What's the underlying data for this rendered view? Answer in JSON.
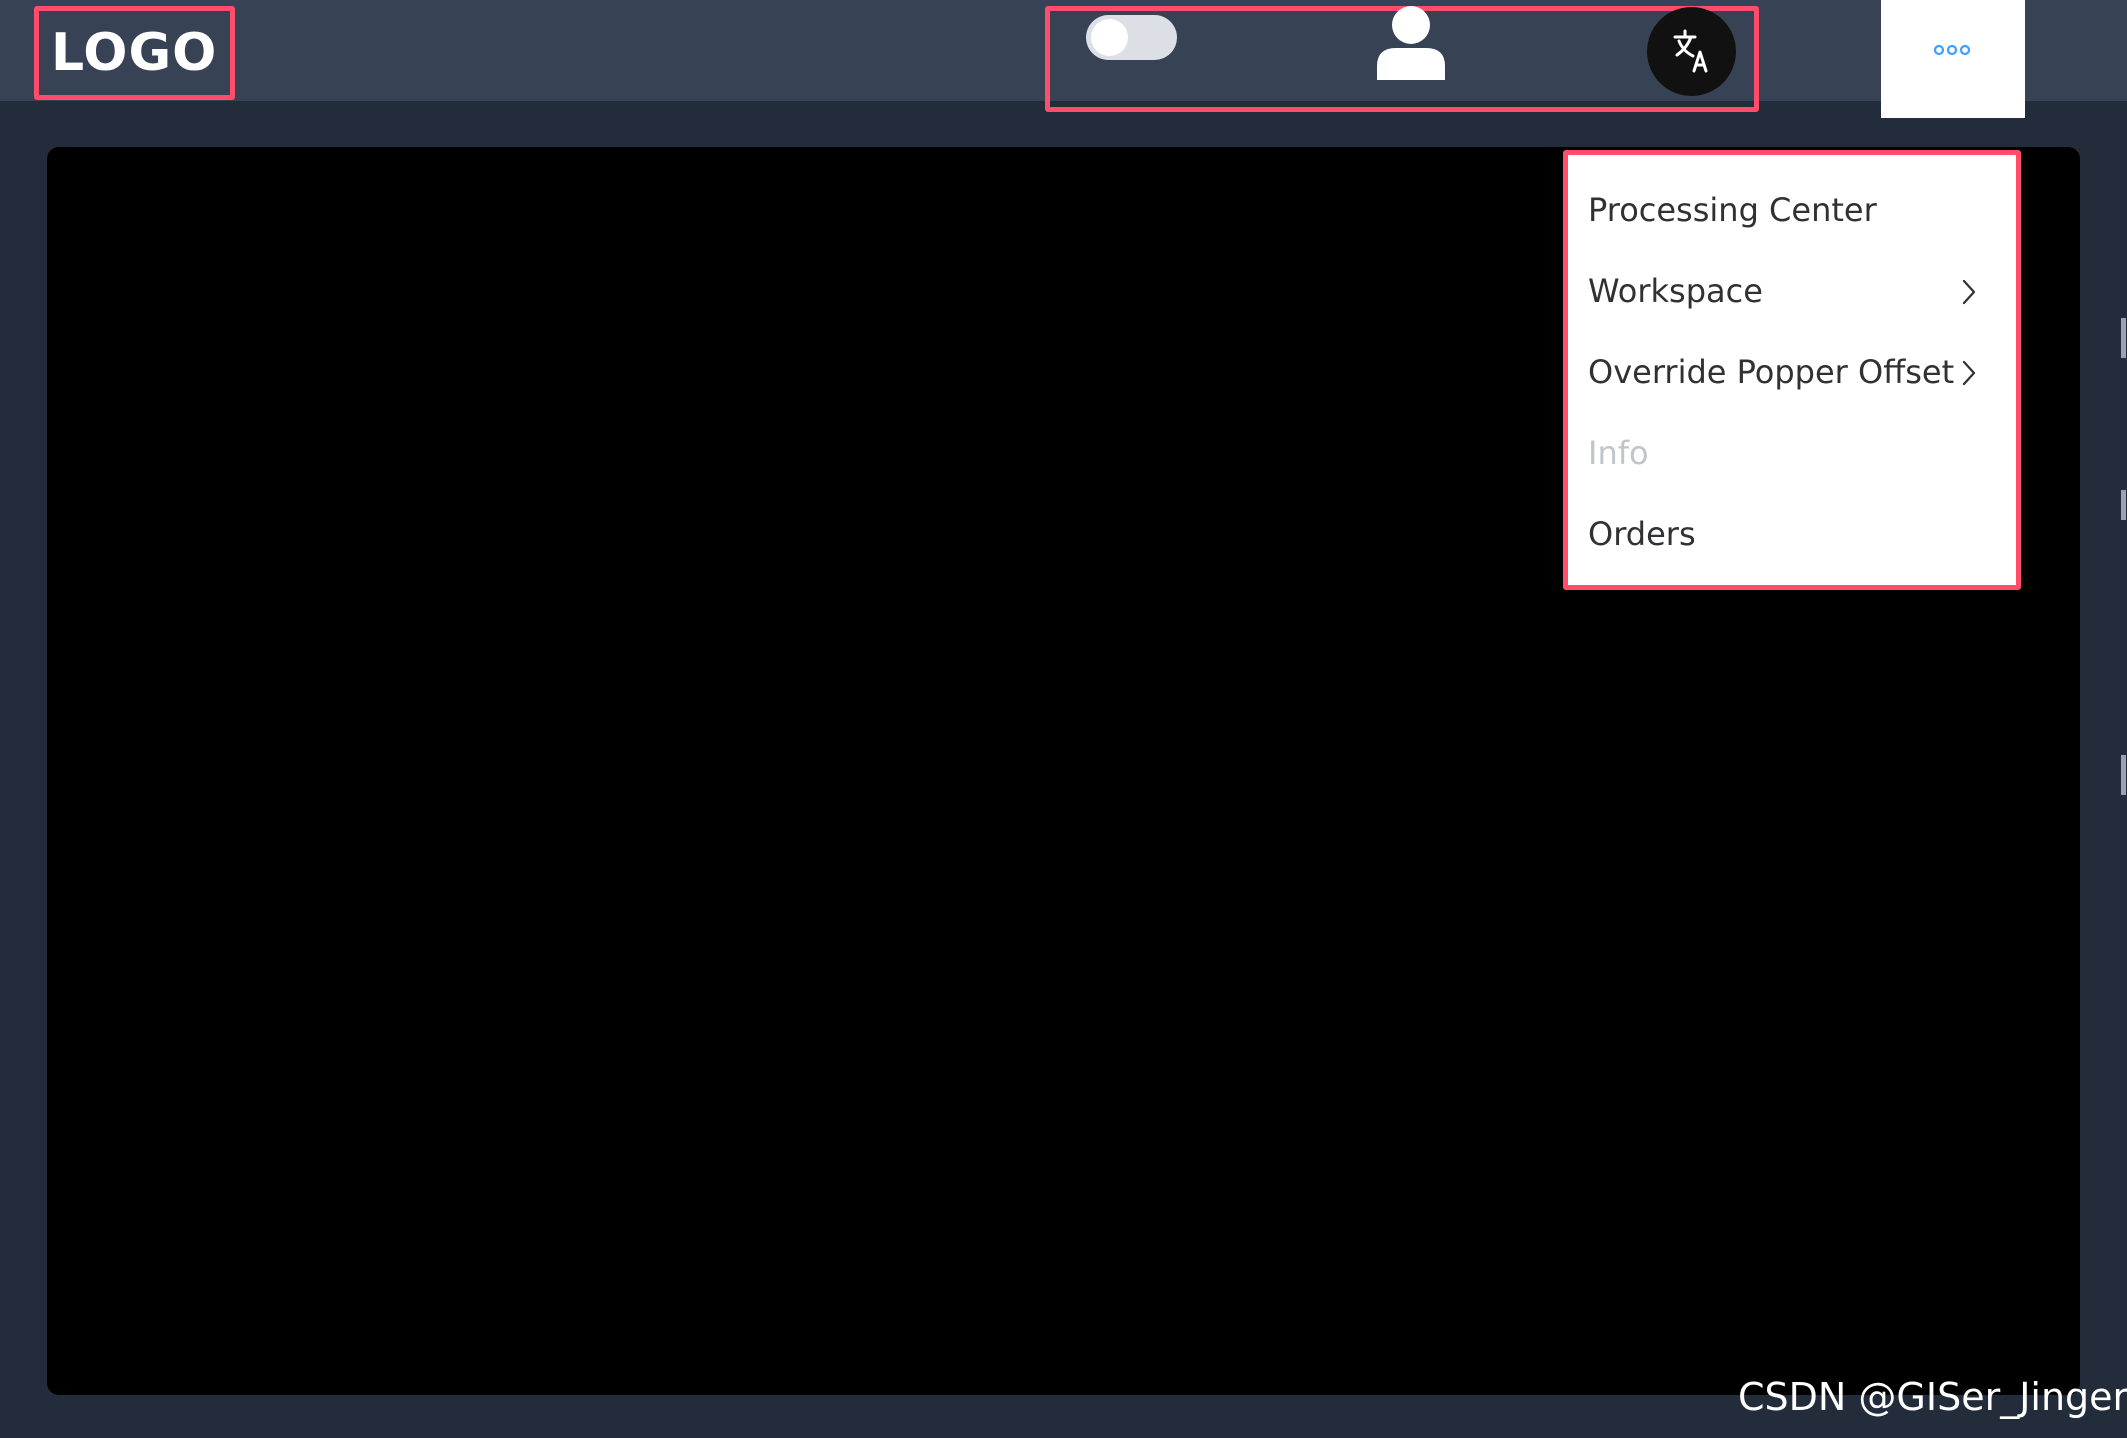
{
  "header": {
    "logo_text": "LOGO",
    "theme_toggle": {
      "state": "off",
      "icon": "toggle-switch"
    },
    "user_icon": "user-icon",
    "language_icon": "translate-icon",
    "more_icon": "ellipsis-icon"
  },
  "dropdown_menu": {
    "items": [
      {
        "label": "Processing Center",
        "submenu": false,
        "disabled": false
      },
      {
        "label": "Workspace",
        "submenu": true,
        "disabled": false
      },
      {
        "label": "Override Popper Offset",
        "submenu": true,
        "disabled": false
      },
      {
        "label": "Info",
        "submenu": false,
        "disabled": true
      },
      {
        "label": "Orders",
        "submenu": false,
        "disabled": false
      }
    ]
  },
  "watermark": "CSDN @GISer_Jinger",
  "colors": {
    "header_bg": "#374254",
    "page_bg": "#232c3b",
    "panel_bg": "#000000",
    "highlight_border": "#ff4d6b",
    "more_icon": "#409eff",
    "disabled_text": "#c0c4cc"
  }
}
